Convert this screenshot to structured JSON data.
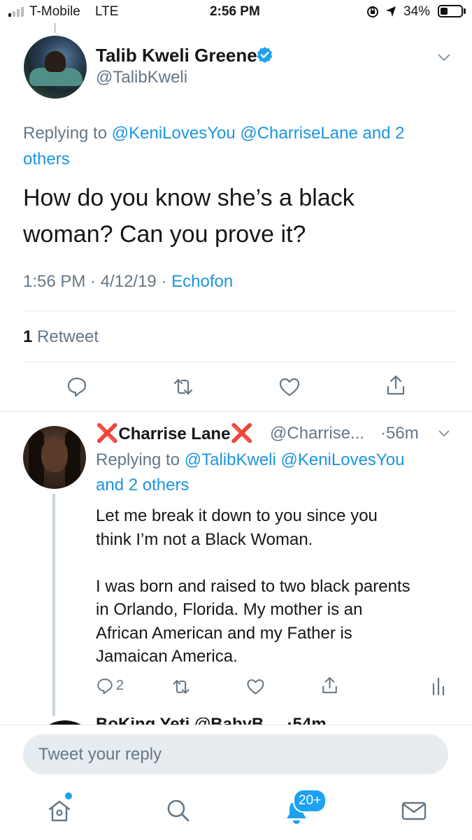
{
  "status_bar": {
    "carrier": "T-Mobile",
    "network": "LTE",
    "time": "2:56 PM",
    "battery": "34%",
    "battery_level": 0.34,
    "signal_bars_filled": 1,
    "icons": [
      "signal-icon",
      "orientation-lock-icon",
      "location-icon",
      "battery-icon"
    ]
  },
  "main_tweet": {
    "author_name": "Talib Kweli Greene",
    "verified": true,
    "handle": "@TalibKweli",
    "replying_to_prefix": "Replying to ",
    "replying_to_line1": "@KeniLovesYou @CharriseLane and 2",
    "replying_to_line2": "others",
    "text_line1": "How do you know she’s a black",
    "text_line2": "woman? Can you prove it?",
    "timestamp": "1:56 PM · 4/12/19 · ",
    "source": "Echofon",
    "retweet_count": "1",
    "retweet_label": " Retweet",
    "actions": [
      "reply-icon",
      "retweet-icon",
      "like-icon",
      "share-icon"
    ]
  },
  "reply_tweet": {
    "name_prefix_emoji": "❌",
    "author_name": "Charrise Lane",
    "name_suffix_emoji": "❌",
    "handle": "@Charrise...",
    "time": "·56m",
    "replying_to_prefix": "Replying to ",
    "replying_to_line1": "@TalibKweli @KeniLovesYou",
    "replying_to_line2": "and 2 others",
    "text_lines_p1": [
      "Let me break it down to you since you",
      "think I’m not a Black Woman."
    ],
    "text_lines_p2": [
      "I was born and raised to two black parents",
      "in Orlando, Florida. My mother is an",
      "African American and my Father is",
      "Jamaican America."
    ],
    "reply_count": "2",
    "actions": [
      "reply-icon",
      "retweet-icon",
      "like-icon",
      "share-icon",
      "analytics-icon"
    ]
  },
  "partial_next": {
    "text": "BoKing Yeti @BabyB ... ·54m"
  },
  "reply_box": {
    "placeholder": "Tweet your reply"
  },
  "tab_bar": {
    "tabs": [
      "home-icon",
      "search-icon",
      "notifications-icon",
      "messages-icon"
    ],
    "notifications_badge": "20+"
  },
  "colors": {
    "link_blue": "#1b95e0",
    "meta_grey": "#657786",
    "divider": "#e1e8ed",
    "badge_blue": "#1da1f2",
    "x_red": "#e0101b"
  }
}
